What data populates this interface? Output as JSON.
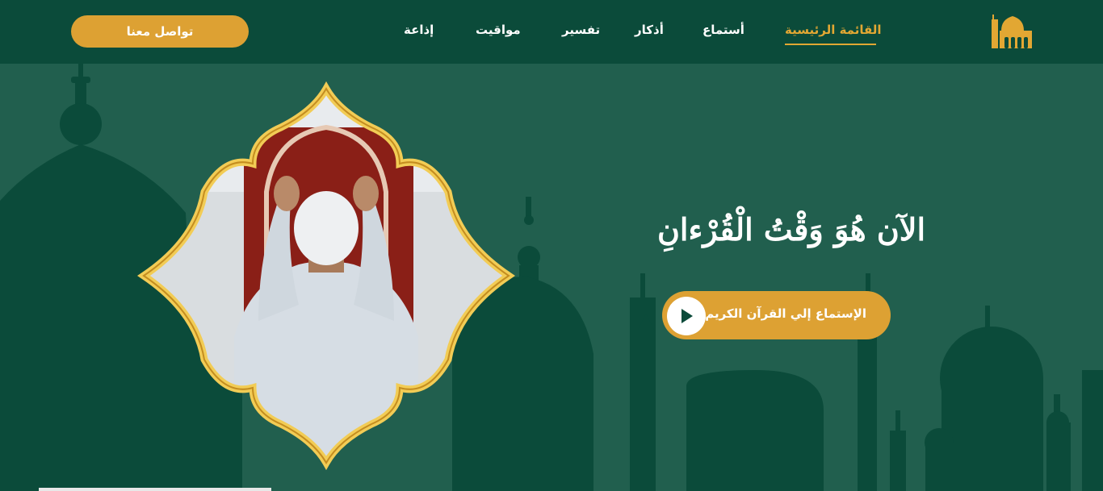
{
  "nav": {
    "items": [
      {
        "label": "القائمة الرئيسية",
        "active": true
      },
      {
        "label": "أستماع",
        "active": false
      },
      {
        "label": "أذكار",
        "active": false
      },
      {
        "label": "تفسير",
        "active": false
      },
      {
        "label": "مواقيت",
        "active": false
      },
      {
        "label": "إذاعة",
        "active": false
      }
    ],
    "contact_label": "تواصل معنا"
  },
  "hero": {
    "title": "الآن هُوَ وَقْتُ الْقُرْءانِ",
    "listen_label": "الإستماع إلي القرآن الكريم"
  },
  "icons": {
    "logo": "mosque-icon",
    "play": "play-icon"
  },
  "colors": {
    "nav_bg": "#0b4b3a",
    "hero_bg": "#215f4e",
    "silhouette": "#0b4b3a",
    "accent": "#dda133",
    "text": "#ffffff"
  }
}
